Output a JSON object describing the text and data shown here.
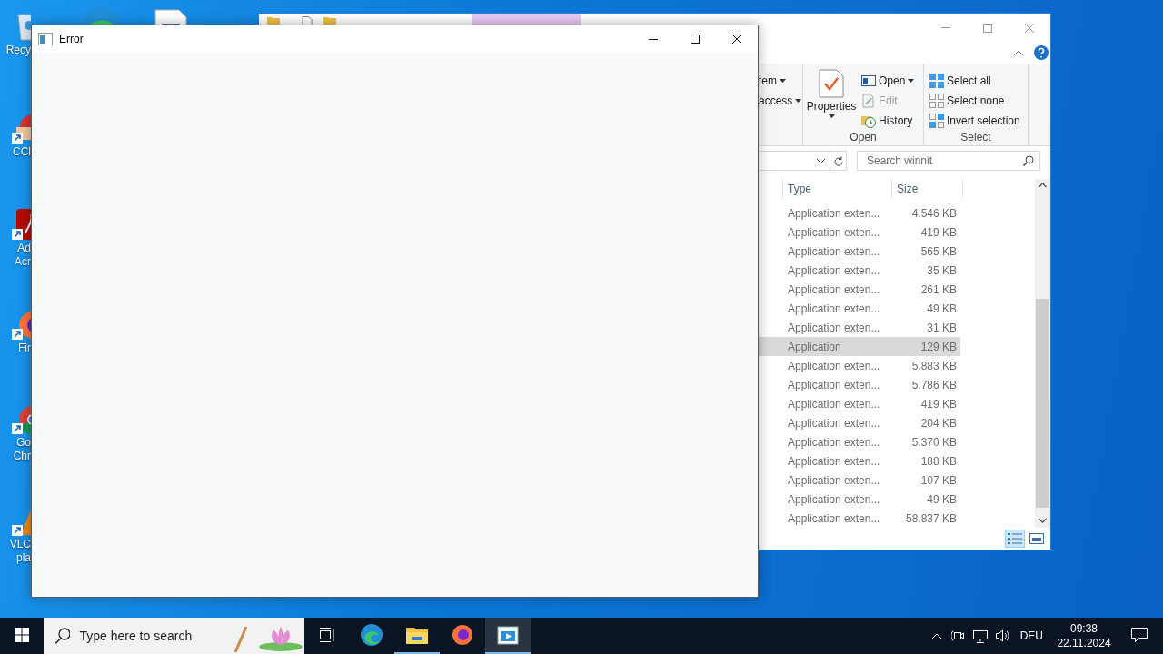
{
  "desktop_icons": [
    {
      "kind": "recycle",
      "lines": [
        "Recy"
      ]
    },
    {
      "kind": "ccleaner",
      "lines": [
        "CCl"
      ]
    },
    {
      "kind": "acrobat",
      "lines": [
        "Ad",
        "Acr"
      ]
    },
    {
      "kind": "firefox",
      "lines": [
        "Fir"
      ]
    },
    {
      "kind": "chrome",
      "lines": [
        "Go",
        "Chr"
      ]
    },
    {
      "kind": "vlc",
      "lines": [
        "VLC",
        "pla"
      ]
    }
  ],
  "explorer": {
    "ribbon": {
      "partial_items": [
        {
          "label": "tem",
          "dropdown": true
        },
        {
          "label": "access",
          "dropdown": true
        }
      ],
      "open_group": {
        "label": "Open",
        "big_button": "Properties",
        "items": [
          {
            "kind": "open",
            "label": "Open",
            "dropdown": true,
            "disabled": false
          },
          {
            "kind": "edit",
            "label": "Edit",
            "dropdown": false,
            "disabled": true
          },
          {
            "kind": "history",
            "label": "History",
            "dropdown": false,
            "disabled": false
          }
        ]
      },
      "select_group": {
        "label": "Select",
        "items": [
          {
            "kind": "select_all",
            "label": "Select all"
          },
          {
            "kind": "select_none",
            "label": "Select none"
          },
          {
            "kind": "invert",
            "label": "Invert selection"
          }
        ]
      }
    },
    "search": {
      "placeholder": "Search winnit"
    },
    "columns": [
      "Type",
      "Size"
    ],
    "rows": [
      {
        "type": "Application exten...",
        "size": "4.546 KB",
        "selected": false
      },
      {
        "type": "Application exten...",
        "size": "419 KB",
        "selected": false
      },
      {
        "type": "Application exten...",
        "size": "565 KB",
        "selected": false
      },
      {
        "type": "Application exten...",
        "size": "35 KB",
        "selected": false
      },
      {
        "type": "Application exten...",
        "size": "261 KB",
        "selected": false
      },
      {
        "type": "Application exten...",
        "size": "49 KB",
        "selected": false
      },
      {
        "type": "Application exten...",
        "size": "31 KB",
        "selected": false
      },
      {
        "type": "Application",
        "size": "129 KB",
        "selected": true
      },
      {
        "type": "Application exten...",
        "size": "5.883 KB",
        "selected": false
      },
      {
        "type": "Application exten...",
        "size": "5.786 KB",
        "selected": false
      },
      {
        "type": "Application exten...",
        "size": "419 KB",
        "selected": false
      },
      {
        "type": "Application exten...",
        "size": "204 KB",
        "selected": false
      },
      {
        "type": "Application exten...",
        "size": "5.370 KB",
        "selected": false
      },
      {
        "type": "Application exten...",
        "size": "188 KB",
        "selected": false
      },
      {
        "type": "Application exten...",
        "size": "107 KB",
        "selected": false
      },
      {
        "type": "Application exten...",
        "size": "49 KB",
        "selected": false
      },
      {
        "type": "Application exten...",
        "size": "58.837 KB",
        "selected": false
      }
    ],
    "view_buttons": [
      {
        "kind": "details",
        "selected": true
      },
      {
        "kind": "large_icons",
        "selected": false
      }
    ]
  },
  "error_window": {
    "title": "Error"
  },
  "taskbar": {
    "search_placeholder": "Type here to search",
    "apps": [
      {
        "kind": "edge",
        "running": false,
        "selected": false
      },
      {
        "kind": "explorer",
        "running": true,
        "selected": false
      },
      {
        "kind": "firefox",
        "running": false,
        "selected": false
      },
      {
        "kind": "window",
        "running": true,
        "selected": true
      }
    ],
    "language": "DEU",
    "time": "09:38",
    "date": "22.11.2024"
  }
}
